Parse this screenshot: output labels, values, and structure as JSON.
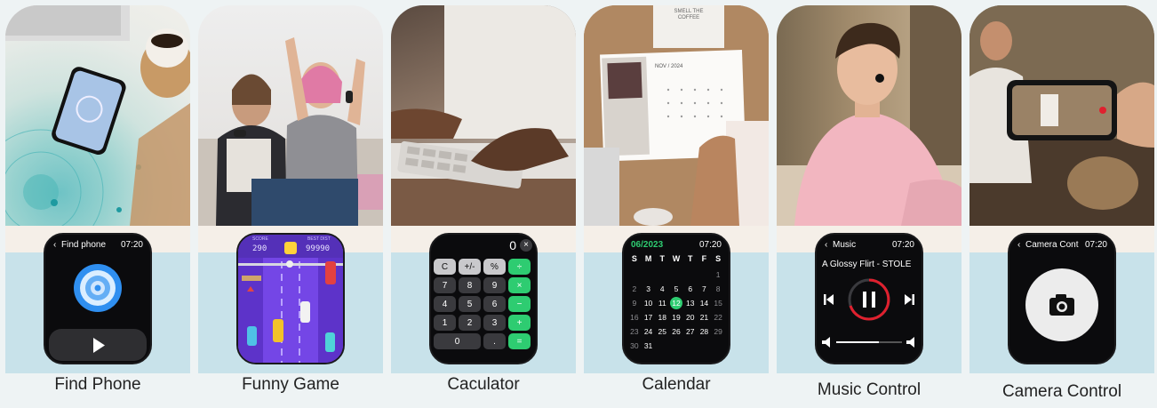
{
  "panels": [
    {
      "caption": "Find Phone",
      "screen": {
        "title": "Find phone",
        "time": "07:20"
      }
    },
    {
      "caption": "Funny Game",
      "screen": {
        "score_label": "SCORE",
        "score": "290",
        "best_label": "BEST DIST",
        "best": "99990"
      }
    },
    {
      "caption": "Caculator",
      "screen": {
        "display": "0",
        "keys": [
          "C",
          "+/-",
          "%",
          "÷",
          "7",
          "8",
          "9",
          "×",
          "4",
          "5",
          "6",
          "−",
          "1",
          "2",
          "3",
          "+",
          "0",
          ".",
          "="
        ]
      }
    },
    {
      "caption": "Calendar",
      "screen": {
        "month": "06/2023",
        "time": "07:20",
        "weekdays": [
          "S",
          "M",
          "T",
          "W",
          "T",
          "F",
          "S"
        ],
        "days": [
          "",
          "",
          "",
          "",
          "",
          "",
          "1",
          "2",
          "3",
          "4",
          "5",
          "6",
          "7",
          "8",
          "9",
          "10",
          "11",
          "12",
          "13",
          "14",
          "15",
          "16",
          "17",
          "18",
          "19",
          "20",
          "21",
          "22",
          "23",
          "24",
          "25",
          "26",
          "27",
          "28",
          "29",
          "30",
          "31",
          "",
          "",
          "",
          "",
          ""
        ],
        "today": "12"
      }
    },
    {
      "caption": "Music Control",
      "screen": {
        "title": "Music",
        "time": "07:20",
        "song": "A Glossy Flirt - STOLE"
      }
    },
    {
      "caption": "Camera Control",
      "screen": {
        "title": "Camera Cont",
        "time": "07:20"
      }
    }
  ],
  "photo_texts": {
    "cal_month": "NOV / 2024",
    "note": "SMELL THE COFFEE"
  },
  "colors": {
    "accent_green": "#2ecc71",
    "band": "#c8e2ea",
    "find_blue": "#2f8ff0",
    "music_red": "#e0202e"
  }
}
